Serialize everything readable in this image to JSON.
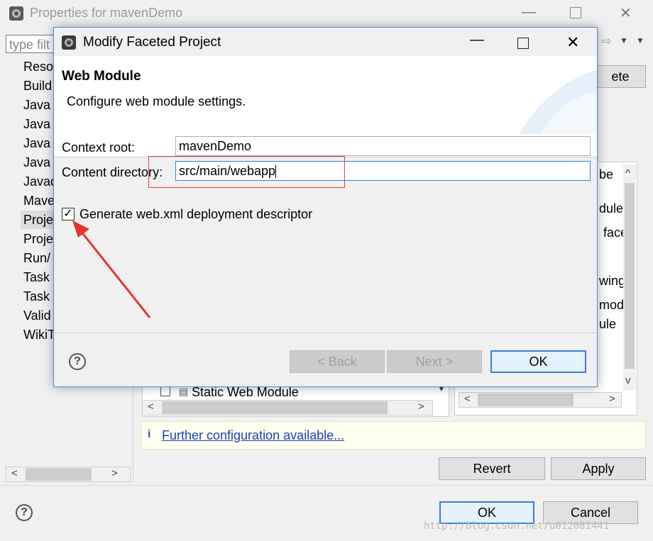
{
  "outer": {
    "title": "Properties for mavenDemo",
    "filter_placeholder": "type filt",
    "tree_items": [
      "Reso",
      "Build",
      "Java",
      "Java",
      "Java",
      "Java",
      "Javad",
      "Mave",
      "Proje",
      "Proje",
      "Run/",
      "Task",
      "Task",
      "Valid",
      "WikiT"
    ],
    "right_buttons_partial": {
      "delete": "ete"
    },
    "right_panel_texts": [
      "be",
      "dule",
      "face",
      "wing",
      "mod",
      "ule"
    ],
    "list_item": "Static Web Module",
    "info_link": "Further configuration available...",
    "revert_label": "Revert",
    "apply_label": "Apply",
    "ok_label": "OK",
    "cancel_label": "Cancel",
    "watermark": "http://blog.csdn.net/u012081441"
  },
  "dialog": {
    "title": "Modify Faceted Project",
    "heading": "Web Module",
    "description": "Configure web module settings.",
    "context_root_label": "Context root:",
    "context_root_value": "mavenDemo",
    "content_dir_label": "Content directory:",
    "content_dir_value": "src/main/webapp",
    "checkbox_label": "Generate web.xml deployment descriptor",
    "checkbox_checked": true,
    "back_label": "< Back",
    "next_label": "Next >",
    "ok_label": "OK"
  },
  "annotation_color": "#e8332a"
}
